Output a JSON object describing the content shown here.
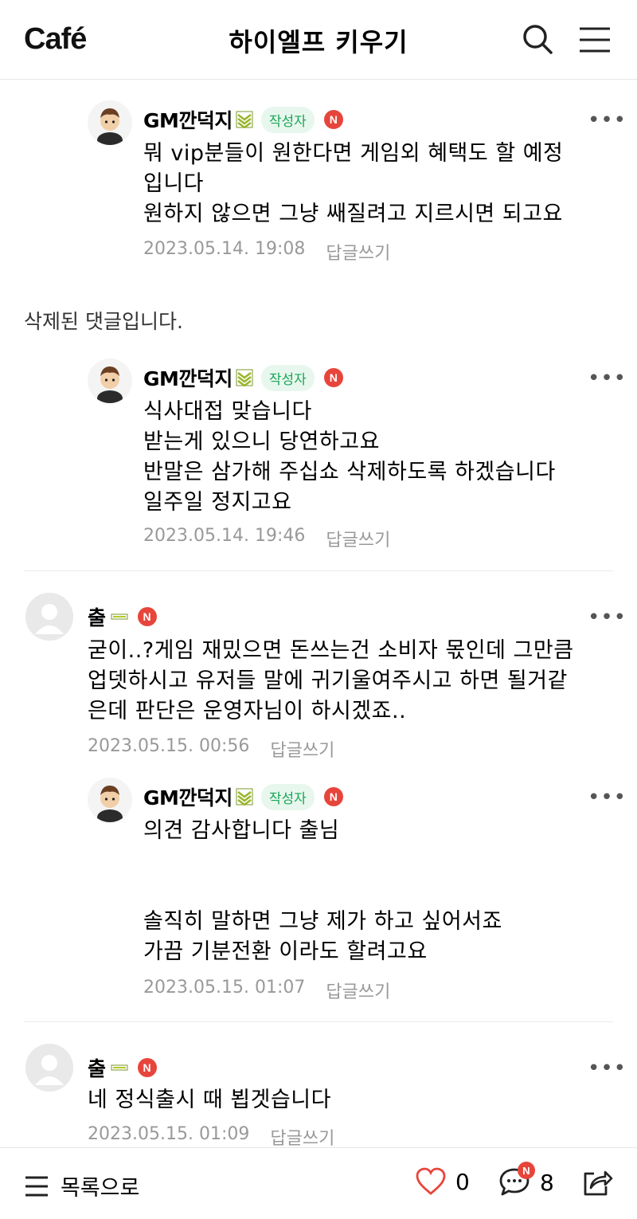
{
  "header": {
    "logo": "Café",
    "title": "하이엘프 키우기"
  },
  "comments": [
    {
      "nickname": "GM깐덕지",
      "writer_badge": "작성자",
      "new_badge": "N",
      "text": "뭐 vip분들이 원한다면 게임외 혜택도 할 예정\n입니다\n원하지 않으면 그냥 쌔질려고 지르시면 되고요",
      "date": "2023.05.14. 19:08",
      "reply_label": "답글쓰기",
      "more": "•••"
    },
    {
      "nickname": "GM깐덕지",
      "writer_badge": "작성자",
      "new_badge": "N",
      "text": "식사대접 맞습니다\n받는게 있으니 당연하고요\n반말은 삼가해 주십쇼 삭제하도록 하겠습니다\n일주일 정지고요",
      "date": "2023.05.14. 19:46",
      "reply_label": "답글쓰기",
      "more": "•••"
    },
    {
      "nickname": "출",
      "new_badge": "N",
      "text": "굳이..?게임 재밌으면 돈쓰는건 소비자 몫인데 그만큼\n업뎃하시고 유저들 말에 귀기울여주시고 하면 될거같\n은데 판단은 운영자님이 하시겠죠..",
      "date": "2023.05.15. 00:56",
      "reply_label": "답글쓰기",
      "more": "•••"
    },
    {
      "nickname": "GM깐덕지",
      "writer_badge": "작성자",
      "new_badge": "N",
      "text": "의견 감사합니다 출님\n\n\n솔직히 말하면 그냥 제가 하고 싶어서죠\n가끔 기분전환 이라도 할려고요",
      "date": "2023.05.15. 01:07",
      "reply_label": "답글쓰기",
      "more": "•••"
    },
    {
      "nickname": "출",
      "new_badge": "N",
      "text": "네 정식출시 때 뵙겟습니다",
      "date": "2023.05.15. 01:09",
      "reply_label": "답글쓰기",
      "more": "•••"
    }
  ],
  "deleted_comment": "삭제된 댓글입니다.",
  "bottom_bar": {
    "list_label": "목록으로",
    "like_count": "0",
    "comment_count": "8",
    "comment_new_badge": "N"
  },
  "colors": {
    "accent_green": "#03c75a",
    "writer_badge_text": "#19a657",
    "new_badge": "#e7453b",
    "like_heart": "#e7453b"
  }
}
